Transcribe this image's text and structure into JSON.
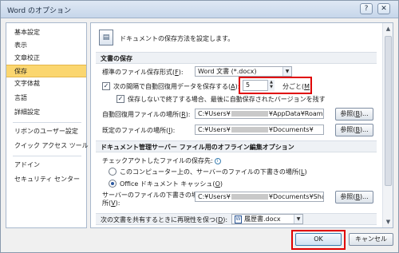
{
  "window": {
    "title": "Word のオプション",
    "help_glyph": "?",
    "close_glyph": "✕"
  },
  "sidebar": {
    "items": [
      "基本設定",
      "表示",
      "文章校正",
      "保存",
      "文字体裁",
      "言語",
      "詳細設定",
      "リボンのユーザー設定",
      "クイック アクセス ツール バー",
      "アドイン",
      "セキュリティ センター"
    ],
    "active": "保存"
  },
  "intro": {
    "text": "ドキュメントの保存方法を設定します。"
  },
  "save_section": {
    "heading": "文書の保存",
    "format_label": "標準のファイル保存形式(",
    "format_key": "F",
    "format_value": "Word 文書 (*.docx)",
    "autosave_label": "次の間隔で自動回復用データを保存する(",
    "autosave_key": "A",
    "autosave_checked": true,
    "autosave_minutes": "5",
    "minutes_suffix": "分ごと(",
    "minutes_key": "M",
    "keep_last_label": "保存しないで終了する場合、最後に自動保存されたバージョンを残す",
    "keep_last_checked": true,
    "autorecover_label": "自動回復用ファイルの場所(",
    "autorecover_key": "R",
    "autorecover_prefix": "C:¥Users¥",
    "autorecover_suffix": "¥AppData¥Roaming¥M",
    "default_loc_label": "既定のファイルの場所(",
    "default_loc_key": "I",
    "default_loc_prefix": "C:¥Users¥",
    "default_loc_suffix": "¥Documents¥",
    "browse_label": "参照(",
    "browse_key": "B"
  },
  "offline_section": {
    "heading": "ドキュメント管理サーバー ファイル用のオフライン編集オプション",
    "checkout_label": "チェックアウトしたファイルの保存先:",
    "option_server_drafts": "このコンピューター上の、サーバーのファイルの下書きの場所(",
    "option_server_drafts_key": "L",
    "option_office_cache": "Office ドキュメント キャッシュ(",
    "option_office_cache_key": "O",
    "selected_option": "office_cache",
    "drafts_label_line1": "サーバーのファイルの下書きの場",
    "drafts_label_line2": "所(",
    "drafts_key": "V",
    "drafts_prefix": "C:¥Users¥",
    "drafts_suffix": "¥Documents¥SharePo"
  },
  "share_row": {
    "label": "次の文書を共有するときに再現性を保つ(",
    "key": "D",
    "document": "履歴書.docx"
  },
  "footer": {
    "ok_label": "OK",
    "cancel_label": "キャンセル"
  },
  "colors": {
    "highlight": "#e00000",
    "active_item": "#fbd66f"
  }
}
